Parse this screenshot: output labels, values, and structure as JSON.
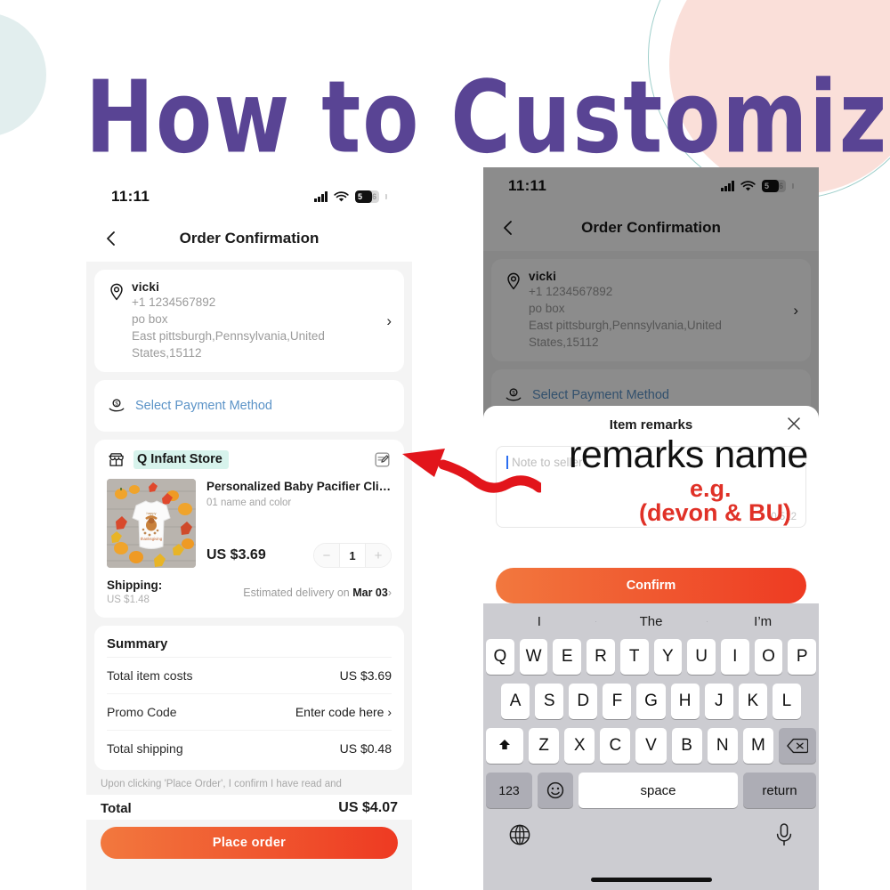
{
  "poster": {
    "title": "How to Customize",
    "title_color": "#594494",
    "accent_orange": "#f2783e",
    "accent_red": "#ee3a22",
    "highlight_mint": "#d7f3ec"
  },
  "phone_left": {
    "status": {
      "time": "11:11",
      "battery": "5",
      "battery_sub": "6",
      "signal_icon": "signal-bars-icon",
      "wifi_icon": "wifi-icon",
      "battery_icon": "battery-icon"
    },
    "nav": {
      "back_icon": "back-arrow-icon",
      "title": "Order Confirmation"
    },
    "address": {
      "pin_icon": "location-pin-icon",
      "name": "vicki",
      "phone": "+1 1234567892",
      "line1": "po box",
      "line2": "East pittsburgh,Pennsylvania,United",
      "line3": "States,15112",
      "chevron_icon": "chevron-right-icon"
    },
    "payment": {
      "icon": "payment-method-icon",
      "label": "Select Payment Method"
    },
    "store": {
      "icon": "store-icon",
      "name": "Q Infant Store",
      "edit_icon": "edit-note-icon"
    },
    "product": {
      "title": "Personalized Baby Pacifier Clip Custo…",
      "variant": "01 name and color",
      "price": "US $3.69",
      "qty": "1",
      "minus": "−",
      "plus": "+",
      "image_alt": "baby-onesie-autumn-pumpkins-photo"
    },
    "shipping": {
      "label": "Shipping:",
      "cost": "US $1.48",
      "delivery_prefix": "Estimated delivery on ",
      "delivery_date": "Mar 03",
      "chevron": "›"
    },
    "summary": {
      "title": "Summary",
      "rows": [
        {
          "label": "Total item costs",
          "value": "US $3.69"
        },
        {
          "label": "Promo Code",
          "value": "Enter code here ›"
        },
        {
          "label": "Total shipping",
          "value": "US $0.48"
        }
      ]
    },
    "footer": {
      "disclaimer": "Upon clicking 'Place Order', I confirm I have read and",
      "total_label": "Total",
      "total_value": "US $4.07",
      "cta": "Place order"
    }
  },
  "phone_right": {
    "status": {
      "time": "11:11",
      "battery": "5",
      "battery_sub": "6"
    },
    "nav": {
      "title": "Order Confirmation"
    },
    "address": {
      "name": "vicki",
      "phone": "+1 1234567892",
      "line1": "po box",
      "line2": "East pittsburgh,Pennsylvania,United",
      "line3": "States,15112"
    },
    "payment": {
      "label": "Select Payment Method"
    },
    "sheet": {
      "title": "Item remarks",
      "close_icon": "close-x-icon",
      "note_placeholder": "Note to seller",
      "char_counter": "0/512",
      "confirm": "Confirm"
    },
    "annotation": {
      "name_text": "remarks name",
      "eg_text": "e.g.",
      "example_text": "(devon & BU)",
      "arrow_icon": "red-wavy-arrow-icon"
    },
    "keyboard": {
      "predictions": [
        "I",
        "The",
        "I’m"
      ],
      "row1": [
        "Q",
        "W",
        "E",
        "R",
        "T",
        "Y",
        "U",
        "I",
        "O",
        "P"
      ],
      "row2": [
        "A",
        "S",
        "D",
        "F",
        "G",
        "H",
        "J",
        "K",
        "L"
      ],
      "row3": [
        "Z",
        "X",
        "C",
        "V",
        "B",
        "N",
        "M"
      ],
      "shift_icon": "shift-arrow-icon",
      "backspace_icon": "backspace-icon",
      "numbers_key": "123",
      "emoji_icon": "emoji-smiley-icon",
      "space_key": "space",
      "return_key": "return",
      "globe_icon": "globe-icon",
      "mic_icon": "microphone-icon"
    }
  }
}
